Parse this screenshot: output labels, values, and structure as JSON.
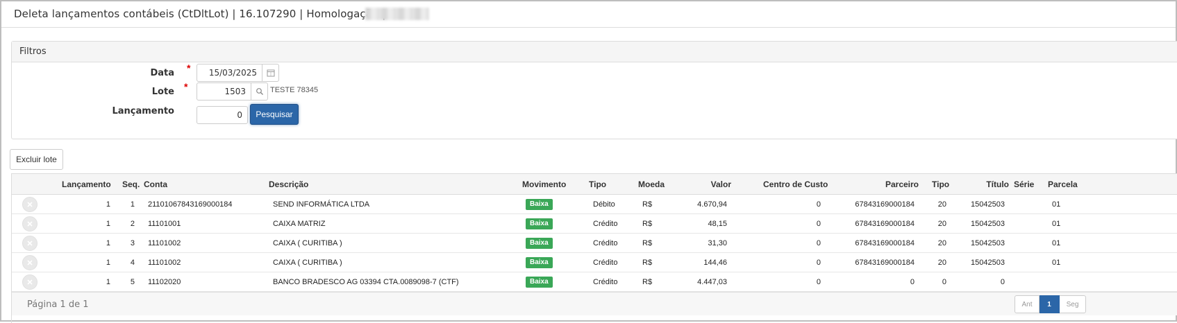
{
  "window": {
    "title": "Deleta lançamentos contábeis (CtDltLot) | 16.107290 | Homologação | S"
  },
  "filters": {
    "header": "Filtros",
    "data_label": "Data",
    "data_value": "15/03/2025",
    "lote_label": "Lote",
    "lote_value": "1503",
    "lote_hint": "TESTE 78345",
    "lancamento_label": "Lançamento",
    "lancamento_value": "0",
    "search_button": "Pesquisar",
    "required_mark": "*"
  },
  "actions": {
    "delete_batch": "Excluir lote"
  },
  "table": {
    "columns": {
      "lancamento": "Lançamento",
      "seq": "Seq.",
      "conta": "Conta",
      "descricao": "Descrição",
      "movimento": "Movimento",
      "tipo": "Tipo",
      "moeda": "Moeda",
      "valor": "Valor",
      "centro_custo": "Centro de Custo",
      "parceiro": "Parceiro",
      "tipo2": "Tipo",
      "titulo": "Título",
      "serie": "Série",
      "parcela": "Parcela"
    },
    "rows": [
      {
        "lancamento": "1",
        "seq": "1",
        "conta": "21101067843169000184",
        "descricao": "SEND INFORMÁTICA LTDA",
        "movimento": "Baixa",
        "tipo": "Débito",
        "moeda": "R$",
        "valor": "4.670,94",
        "centro_custo": "0",
        "parceiro": "67843169000184",
        "tipo2": "20",
        "titulo": "15042503",
        "serie": "",
        "parcela": "01"
      },
      {
        "lancamento": "1",
        "seq": "2",
        "conta": "11101001",
        "descricao": "CAIXA MATRIZ",
        "movimento": "Baixa",
        "tipo": "Crédito",
        "moeda": "R$",
        "valor": "48,15",
        "centro_custo": "0",
        "parceiro": "67843169000184",
        "tipo2": "20",
        "titulo": "15042503",
        "serie": "",
        "parcela": "01"
      },
      {
        "lancamento": "1",
        "seq": "3",
        "conta": "11101002",
        "descricao": "CAIXA ( CURITIBA )",
        "movimento": "Baixa",
        "tipo": "Crédito",
        "moeda": "R$",
        "valor": "31,30",
        "centro_custo": "0",
        "parceiro": "67843169000184",
        "tipo2": "20",
        "titulo": "15042503",
        "serie": "",
        "parcela": "01"
      },
      {
        "lancamento": "1",
        "seq": "4",
        "conta": "11101002",
        "descricao": "CAIXA ( CURITIBA )",
        "movimento": "Baixa",
        "tipo": "Crédito",
        "moeda": "R$",
        "valor": "144,46",
        "centro_custo": "0",
        "parceiro": "67843169000184",
        "tipo2": "20",
        "titulo": "15042503",
        "serie": "",
        "parcela": "01"
      },
      {
        "lancamento": "1",
        "seq": "5",
        "conta": "11102020",
        "descricao": "BANCO BRADESCO AG 03394 CTA.0089098-7 (CTF)",
        "movimento": "Baixa",
        "tipo": "Crédito",
        "moeda": "R$",
        "valor": "4.447,03",
        "centro_custo": "0",
        "parceiro": "0",
        "tipo2": "0",
        "titulo": "0",
        "serie": "",
        "parcela": ""
      }
    ],
    "badge_color": "#3aa757"
  },
  "pagination": {
    "info": "Página 1 de 1",
    "prev": "Ant",
    "current": "1",
    "next": "Seg"
  },
  "colors": {
    "primary": "#2b66a8",
    "success": "#3aa757"
  }
}
